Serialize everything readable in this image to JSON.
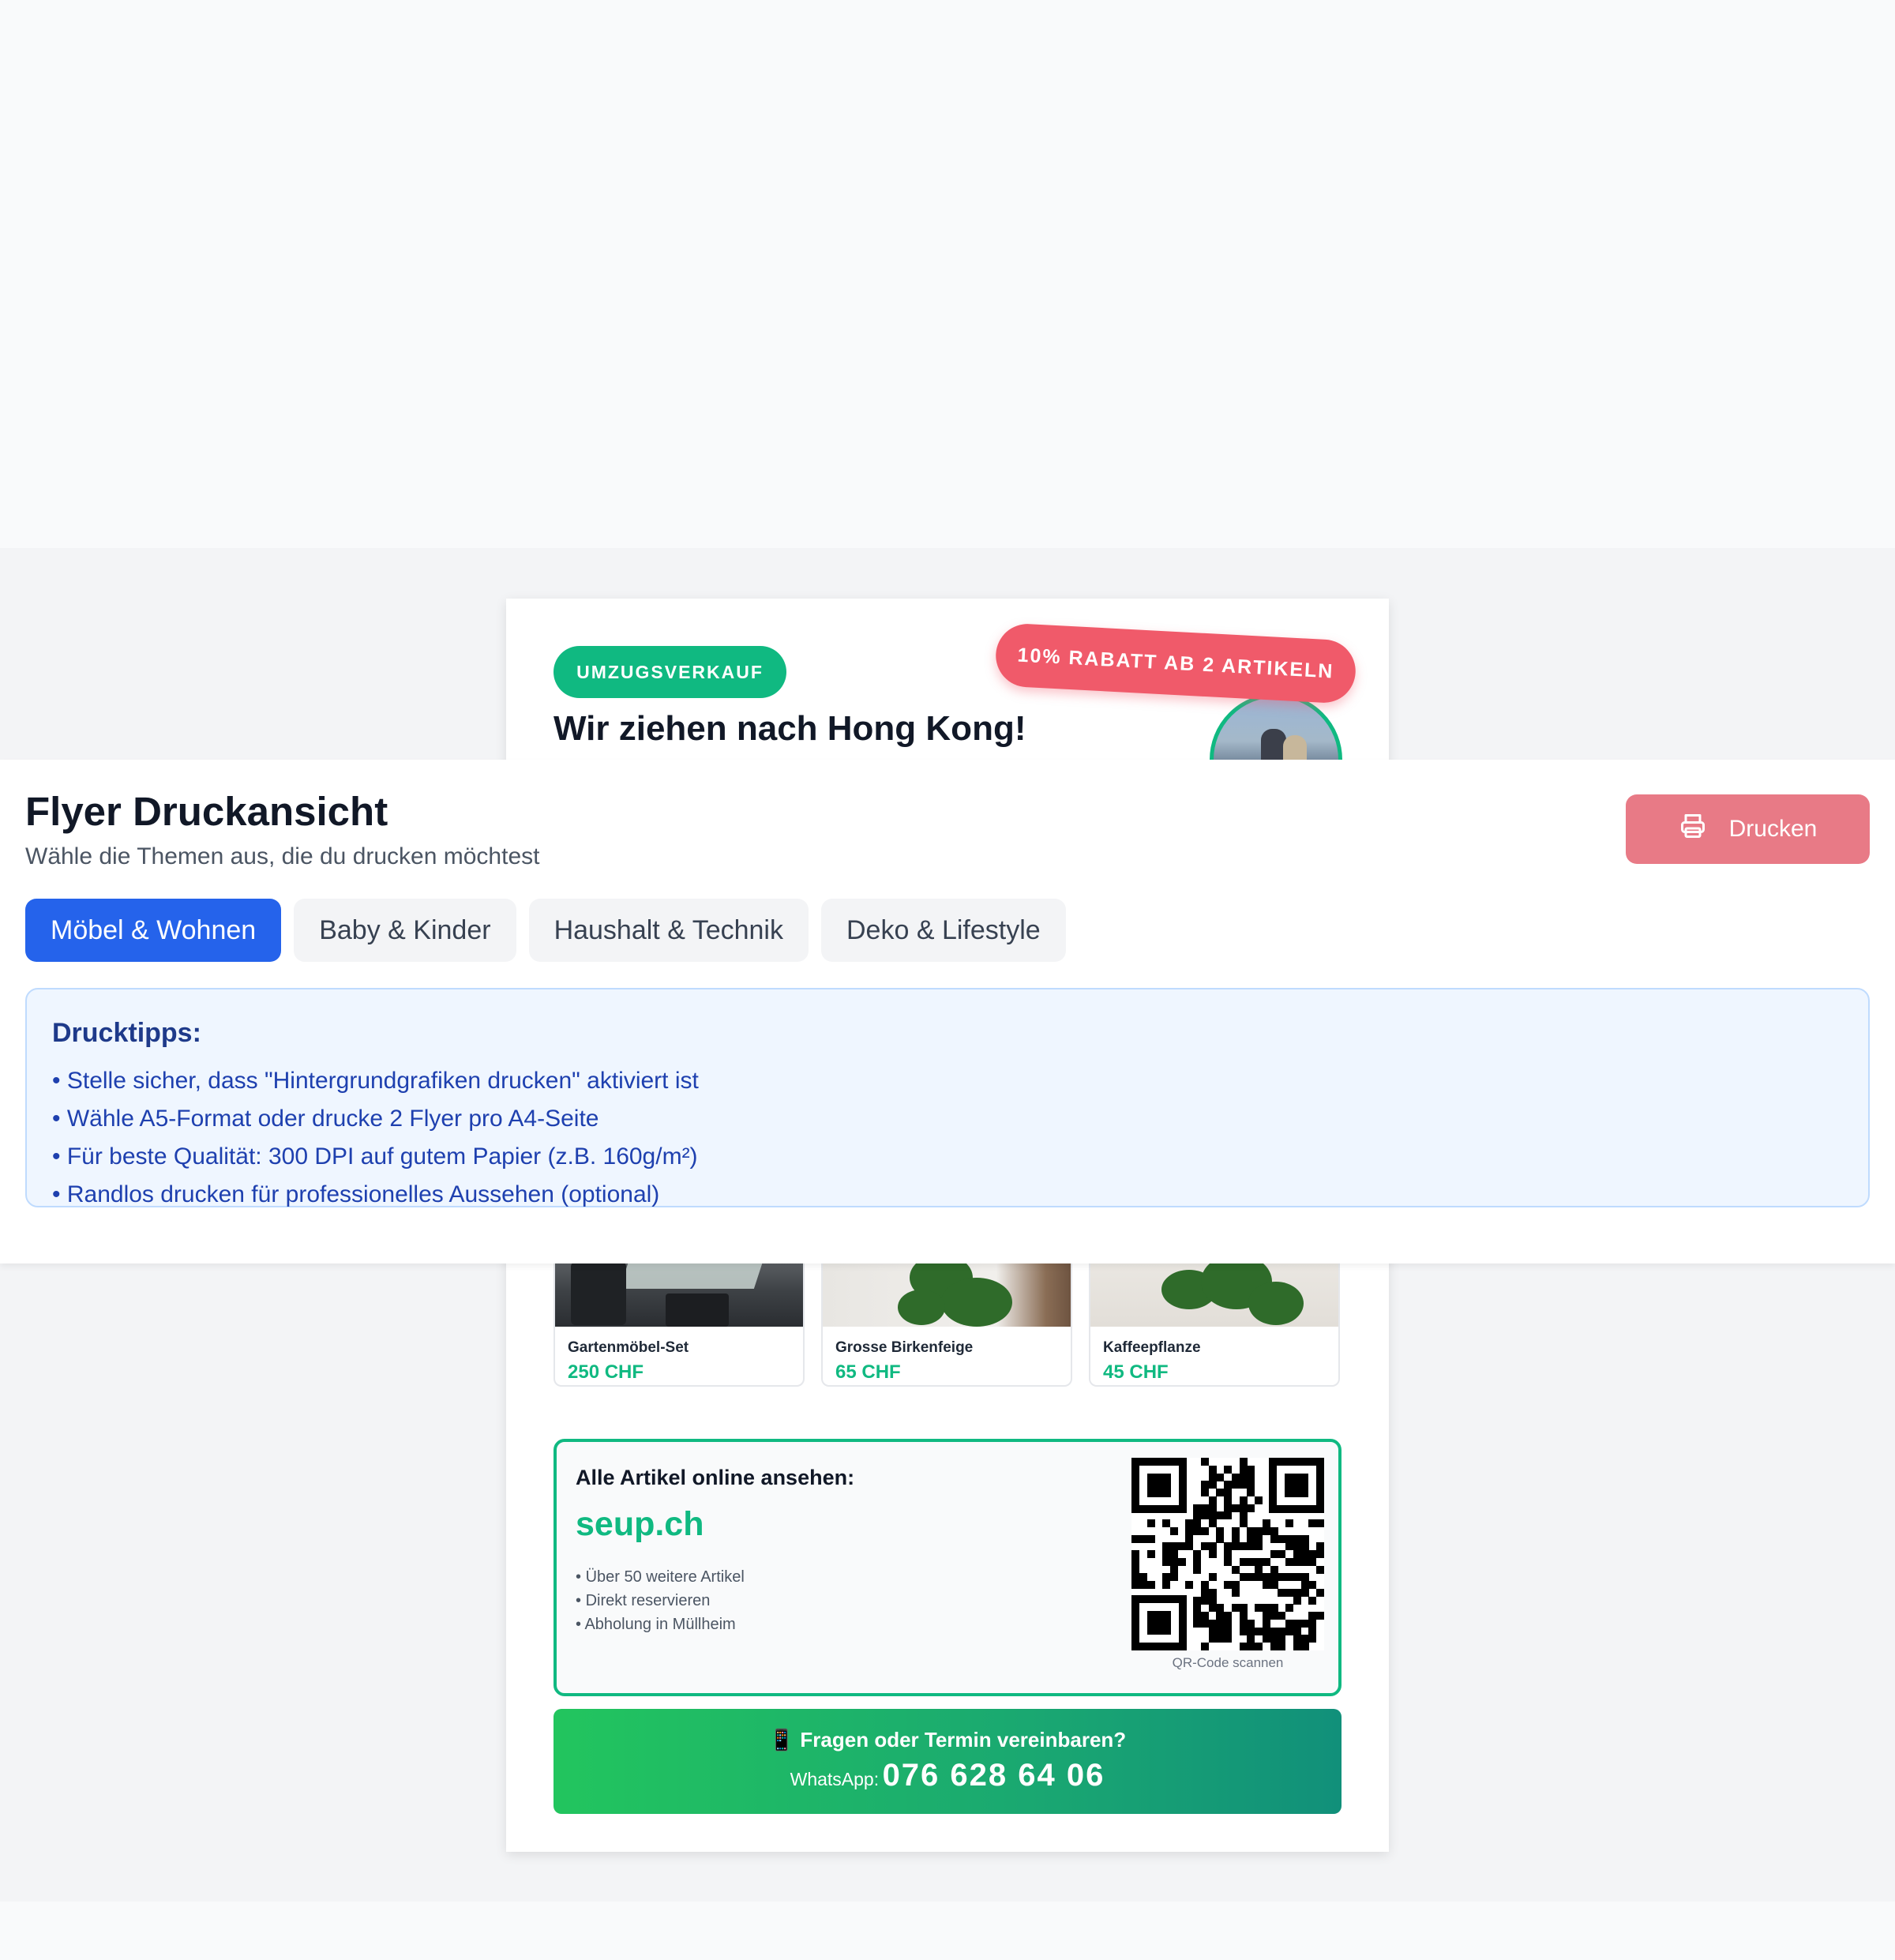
{
  "panel": {
    "title": "Flyer Druckansicht",
    "subtitle": "Wähle die Themen aus, die du drucken möchtest",
    "print_label": "Drucken",
    "tabs": [
      {
        "label": "Möbel & Wohnen",
        "active": true
      },
      {
        "label": "Baby & Kinder",
        "active": false
      },
      {
        "label": "Haushalt & Technik",
        "active": false
      },
      {
        "label": "Deko & Lifestyle",
        "active": false
      }
    ],
    "tips": {
      "heading": "Drucktipps:",
      "items": [
        "Stelle sicher, dass \"Hintergrundgrafiken drucken\" aktiviert ist",
        "Wähle A5-Format oder drucke 2 Flyer pro A4-Seite",
        "Für beste Qualität: 300 DPI auf gutem Papier (z.B. 160g/m²)",
        "Randlos drucken für professionelles Aussehen (optional)"
      ]
    }
  },
  "flyer": {
    "badge": "UMZUGSVERKAUF",
    "ribbon": "10% RABATT AB 2 ARTIKELN",
    "headline": "Wir ziehen nach Hong Kong!",
    "products": [
      {
        "name": "Gartenmöbel-Set",
        "price": "250 CHF"
      },
      {
        "name": "Grosse Birkenfeige",
        "price": "65 CHF"
      },
      {
        "name": "Kaffeepflanze",
        "price": "45 CHF"
      }
    ],
    "online": {
      "title": "Alle Artikel online ansehen:",
      "url": "seup.ch",
      "features": [
        "Über 50 weitere Artikel",
        "Direkt reservieren",
        "Abholung in Müllheim"
      ],
      "qr_caption": "QR-Code scannen"
    },
    "contact": {
      "question": "📱 Fragen oder Termin vereinbaren?",
      "whatsapp_label": "WhatsApp:",
      "phone": "076 628 64 06"
    }
  },
  "colors": {
    "brand_green": "#10b981",
    "ribbon_red": "#f05a6a",
    "tab_active_blue": "#2563eb",
    "print_button": "#e87a86",
    "tips_background": "#eff6ff"
  },
  "icons": {
    "print": "printer-icon"
  }
}
